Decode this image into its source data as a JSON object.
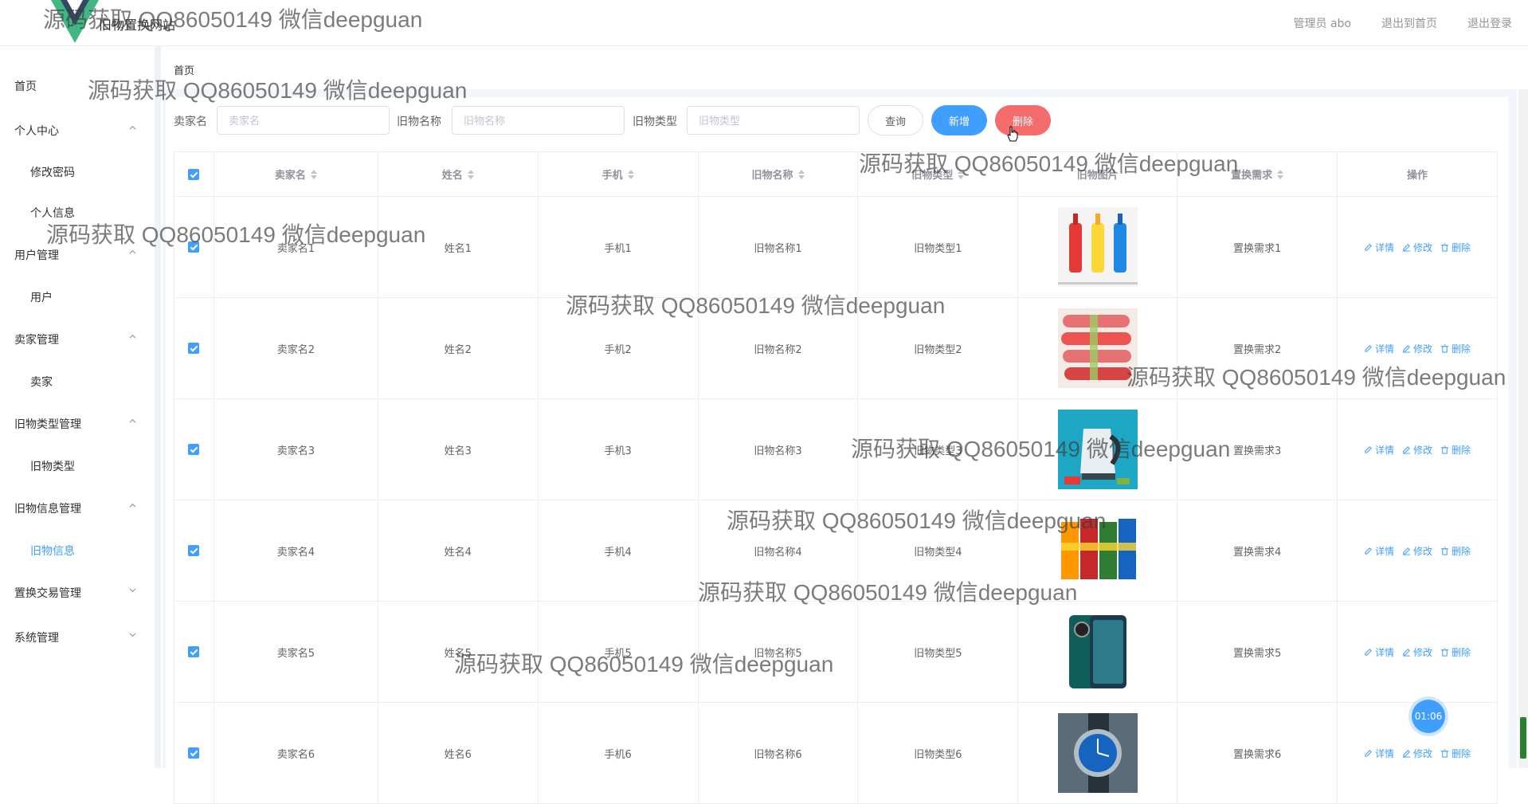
{
  "header": {
    "site_title": "旧物置换网站",
    "admin_label": "管理员 abo",
    "back_home": "退出到首页",
    "logout": "退出登录"
  },
  "sidebar": {
    "items": [
      {
        "label": "首页"
      },
      {
        "label": "个人中心",
        "children": [
          "修改密码",
          "个人信息"
        ]
      },
      {
        "label": "用户管理",
        "children": [
          "用户"
        ]
      },
      {
        "label": "卖家管理",
        "children": [
          "卖家"
        ]
      },
      {
        "label": "旧物类型管理",
        "children": [
          "旧物类型"
        ]
      },
      {
        "label": "旧物信息管理",
        "children": [
          "旧物信息"
        ]
      },
      {
        "label": "置换交易管理"
      },
      {
        "label": "系统管理"
      }
    ]
  },
  "breadcrumb": "首页",
  "search": {
    "seller_label": "卖家名",
    "seller_placeholder": "卖家名",
    "name_label": "旧物名称",
    "name_placeholder": "旧物名称",
    "type_label": "旧物类型",
    "type_placeholder": "旧物类型",
    "query_btn": "查询",
    "add_btn": "新增",
    "delete_btn": "删除"
  },
  "table": {
    "headers": [
      "卖家名",
      "姓名",
      "手机",
      "旧物名称",
      "旧物类型",
      "旧物图片",
      "置换需求",
      "操作"
    ],
    "actions": {
      "detail": "详情",
      "edit": "修改",
      "delete": "删除"
    },
    "rows": [
      {
        "seller": "卖家名1",
        "name": "姓名1",
        "phone": "手机1",
        "item": "旧物名称1",
        "type": "旧物类型1",
        "image": "drink-bottles",
        "need": "置换需求1"
      },
      {
        "seller": "卖家名2",
        "name": "姓名2",
        "phone": "手机2",
        "item": "旧物名称2",
        "type": "旧物类型2",
        "image": "sausages",
        "need": "置换需求2"
      },
      {
        "seller": "卖家名3",
        "name": "姓名3",
        "phone": "手机3",
        "item": "旧物名称3",
        "type": "旧物类型3",
        "image": "electric-kettle",
        "need": "置换需求3"
      },
      {
        "seller": "卖家名4",
        "name": "姓名4",
        "phone": "手机4",
        "item": "旧物名称4",
        "type": "旧物类型4",
        "image": "snack-packs",
        "need": "置换需求4"
      },
      {
        "seller": "卖家名5",
        "name": "姓名5",
        "phone": "手机5",
        "item": "旧物名称5",
        "type": "旧物类型5",
        "image": "smartphone",
        "need": "置换需求5"
      },
      {
        "seller": "卖家名6",
        "name": "姓名6",
        "phone": "手机6",
        "item": "旧物名称6",
        "type": "旧物类型6",
        "image": "wristwatch",
        "need": "置换需求6"
      }
    ]
  },
  "timer": "01:06",
  "watermark": "源码获取 QQ86050149 微信deepguan",
  "colors": {
    "primary": "#409eff",
    "danger": "#f56c6c",
    "logo_green": "#41b883",
    "logo_dark": "#35495e"
  }
}
